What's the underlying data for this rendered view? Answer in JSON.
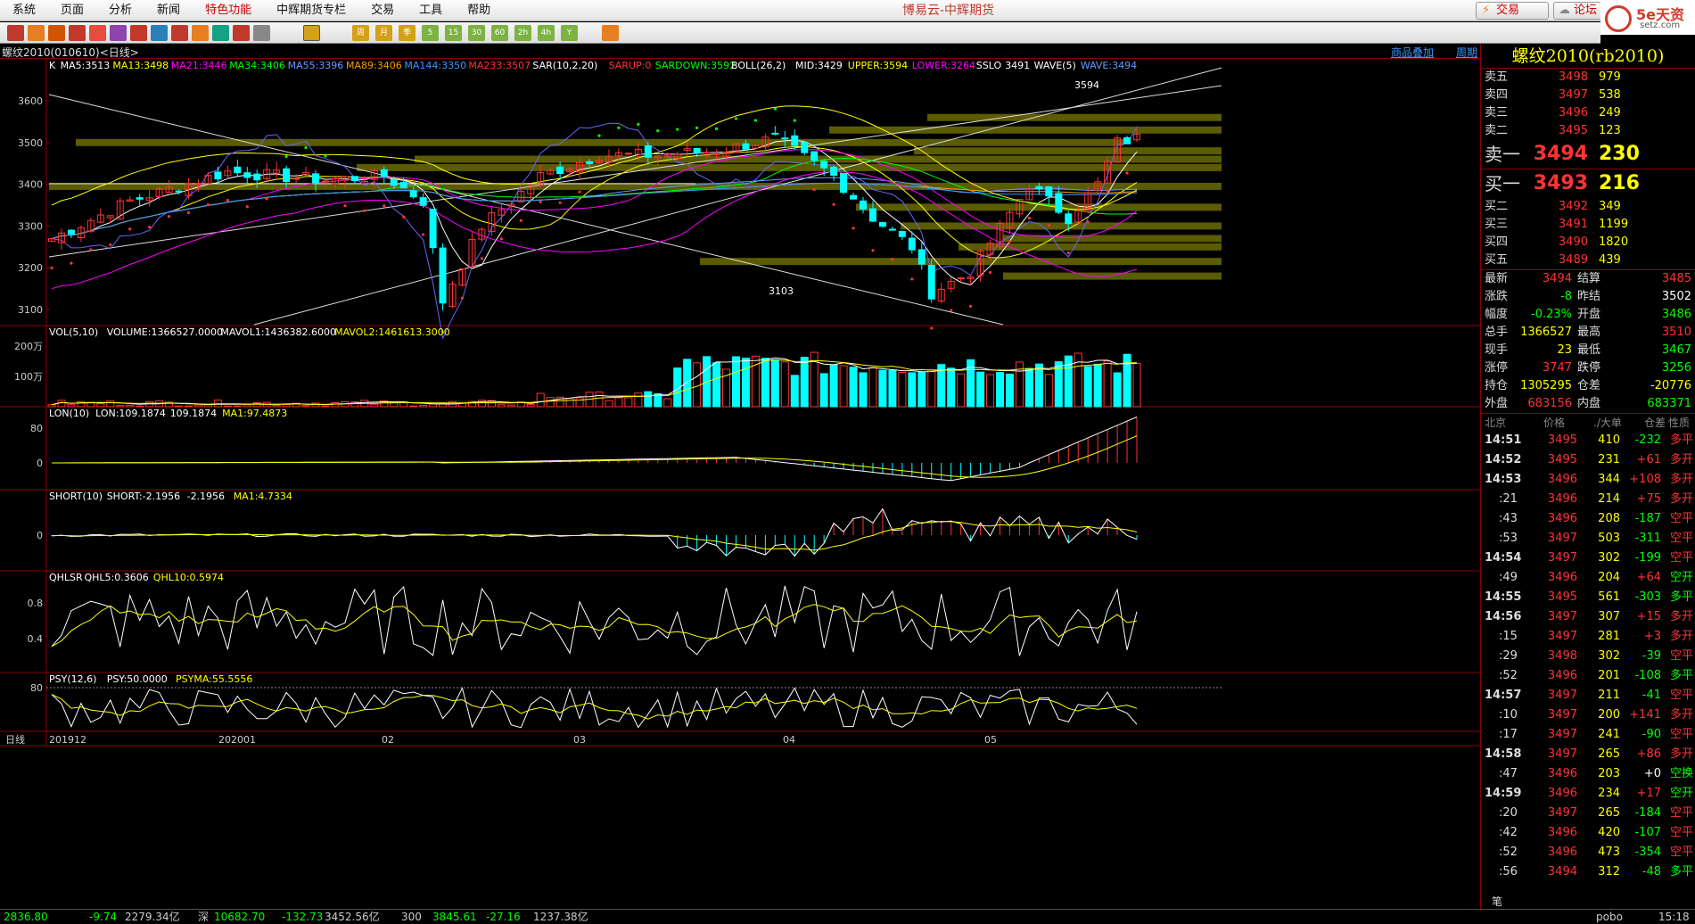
{
  "menu": [
    "系统",
    "页面",
    "分析",
    "新闻",
    "特色功能",
    "中辉期货专栏",
    "交易",
    "工具",
    "帮助"
  ],
  "app_title": "博易云-中辉期货",
  "buttons": {
    "trade": "交易",
    "forum": "论坛"
  },
  "logo": {
    "big": "5e天资",
    "small": "setz.com"
  },
  "toolbar_labels": [
    "周",
    "月",
    "季",
    "5",
    "15",
    "30",
    "60",
    "2h",
    "4h",
    "Y"
  ],
  "chart": {
    "symbol": "螺纹2010(010610)<日线>",
    "links": [
      "商品叠加",
      "周期"
    ],
    "ma_line": [
      {
        "t": "K",
        "c": "#ffffff"
      },
      {
        "t": "MA5:3513",
        "c": "#ffffff"
      },
      {
        "t": "MA13:3498",
        "c": "#ffff00"
      },
      {
        "t": "MA21:3446",
        "c": "#ff00ff"
      },
      {
        "t": "MA34:3406",
        "c": "#00ff00"
      },
      {
        "t": "MA55:3396",
        "c": "#6699ff"
      },
      {
        "t": "MA89:3406",
        "c": "#ff9900"
      },
      {
        "t": "MA144:3350",
        "c": "#3399ff"
      },
      {
        "t": "MA233:3507",
        "c": "#ff3333"
      },
      {
        "t": "SAR(10,2,20)",
        "c": "#ffffff"
      },
      {
        "t": "SARUP:0",
        "c": "#ff3333"
      },
      {
        "t": "SARDOWN:3592",
        "c": "#00ff00"
      },
      {
        "t": "BOLL(26,2)",
        "c": "#ffffff"
      },
      {
        "t": "MID:3429",
        "c": "#ffffff"
      },
      {
        "t": "UPPER:3594",
        "c": "#ffff00"
      },
      {
        "t": "LOWER:3264",
        "c": "#ff00ff"
      },
      {
        "t": "SSLO",
        "c": "#ffffff"
      },
      {
        "t": "3491",
        "c": "#ffffff"
      },
      {
        "t": "WAVE(5)",
        "c": "#ffffff"
      },
      {
        "t": "WAVE:3494",
        "c": "#6699ff"
      }
    ],
    "price_axis": [
      "3600",
      "3500",
      "3400",
      "3300",
      "3200",
      "3100"
    ],
    "high_label": "3594",
    "low_label": "3103",
    "vol_line": [
      {
        "t": "VOL(5,10)",
        "c": "#fff"
      },
      {
        "t": "VOLUME:1366527.0000",
        "c": "#fff"
      },
      {
        "t": "MAVOL1:1436382.6000",
        "c": "#fff"
      },
      {
        "t": "MAVOL2:1461613.3000",
        "c": "#ff0"
      }
    ],
    "vol_axis": [
      "200万",
      "100万"
    ],
    "lon_line": [
      {
        "t": "LON(10)",
        "c": "#fff"
      },
      {
        "t": "LON:109.1874",
        "c": "#fff"
      },
      {
        "t": "109.1874",
        "c": "#fff"
      },
      {
        "t": "MA1:97.4873",
        "c": "#ff0"
      }
    ],
    "lon_axis": [
      "80",
      "0"
    ],
    "short_line": [
      {
        "t": "SHORT(10)",
        "c": "#fff"
      },
      {
        "t": "SHORT:-2.1956",
        "c": "#fff"
      },
      {
        "t": "-2.1956",
        "c": "#fff"
      },
      {
        "t": "MA1:4.7334",
        "c": "#ff0"
      }
    ],
    "short_axis": [
      "0"
    ],
    "qhlsr_line": [
      {
        "t": "QHLSR",
        "c": "#fff"
      },
      {
        "t": "QHL5:0.3606",
        "c": "#fff"
      },
      {
        "t": "QHL10:0.5974",
        "c": "#ff0"
      }
    ],
    "qhlsr_axis": [
      "0.8",
      "0.4"
    ],
    "psy_line": [
      {
        "t": "PSY(12,6)",
        "c": "#fff"
      },
      {
        "t": "PSY:50.0000",
        "c": "#fff"
      },
      {
        "t": "PSYMA:55.5556",
        "c": "#ff0"
      }
    ],
    "psy_axis": [
      "80"
    ],
    "date_axis": [
      "日线",
      "201912",
      "202001",
      "02",
      "03",
      "04",
      "05"
    ]
  },
  "quote": {
    "title": "螺纹2010(rb2010)",
    "asks": [
      {
        "l": "卖五",
        "p": "3498",
        "v": "979"
      },
      {
        "l": "卖四",
        "p": "3497",
        "v": "538"
      },
      {
        "l": "卖三",
        "p": "3496",
        "v": "249"
      },
      {
        "l": "卖二",
        "p": "3495",
        "v": "123"
      },
      {
        "l": "卖一",
        "p": "3494",
        "v": "230"
      }
    ],
    "bids": [
      {
        "l": "买一",
        "p": "3493",
        "v": "216"
      },
      {
        "l": "买二",
        "p": "3492",
        "v": "349"
      },
      {
        "l": "买三",
        "p": "3491",
        "v": "1199"
      },
      {
        "l": "买四",
        "p": "3490",
        "v": "1820"
      },
      {
        "l": "买五",
        "p": "3489",
        "v": "439"
      }
    ],
    "stats": [
      {
        "l1": "最新",
        "v1": "3494",
        "c1": "#f33",
        "l2": "结算",
        "v2": "3485",
        "c2": "#f33"
      },
      {
        "l1": "涨跌",
        "v1": "-8",
        "c1": "#0f0",
        "l2": "昨结",
        "v2": "3502",
        "c2": "#fff"
      },
      {
        "l1": "幅度",
        "v1": "-0.23%",
        "c1": "#0f0",
        "l2": "开盘",
        "v2": "3486",
        "c2": "#0f0"
      },
      {
        "l1": "总手",
        "v1": "1366527",
        "c1": "#ff0",
        "l2": "最高",
        "v2": "3510",
        "c2": "#f33"
      },
      {
        "l1": "现手",
        "v1": "23",
        "c1": "#ff0",
        "l2": "最低",
        "v2": "3467",
        "c2": "#0f0"
      },
      {
        "l1": "涨停",
        "v1": "3747",
        "c1": "#f33",
        "l2": "跌停",
        "v2": "3256",
        "c2": "#0f0"
      },
      {
        "l1": "持仓",
        "v1": "1305295",
        "c1": "#ff0",
        "l2": "仓差",
        "v2": "-20776",
        "c2": "#ff0"
      },
      {
        "l1": "外盘",
        "v1": "683156",
        "c1": "#f33",
        "l2": "内盘",
        "v2": "683371",
        "c2": "#0f0"
      }
    ],
    "tick_header": [
      "北京",
      "价格",
      "./大单",
      "仓差",
      "性质"
    ],
    "ticks": [
      {
        "t": "14:51",
        "p": "3495",
        "v": "410",
        "d": "-232",
        "k": "多平",
        "pc": "#f33",
        "vc": "#ff0",
        "dc": "#0f0",
        "kc": "#f33"
      },
      {
        "t": "14:52",
        "p": "3495",
        "v": "231",
        "d": "+61",
        "k": "多开",
        "pc": "#f33",
        "vc": "#ff0",
        "dc": "#f33",
        "kc": "#f33"
      },
      {
        "t": "14:53",
        "p": "3496",
        "v": "344",
        "d": "+108",
        "k": "多开",
        "pc": "#f33",
        "vc": "#ff0",
        "dc": "#f33",
        "kc": "#f33"
      },
      {
        "t": ":21",
        "p": "3496",
        "v": "214",
        "d": "+75",
        "k": "多开",
        "pc": "#f33",
        "vc": "#ff0",
        "dc": "#f33",
        "kc": "#f33"
      },
      {
        "t": ":43",
        "p": "3496",
        "v": "208",
        "d": "-187",
        "k": "空平",
        "pc": "#f33",
        "vc": "#ff0",
        "dc": "#0f0",
        "kc": "#f33"
      },
      {
        "t": ":53",
        "p": "3497",
        "v": "503",
        "d": "-311",
        "k": "空平",
        "pc": "#f33",
        "vc": "#ff0",
        "dc": "#0f0",
        "kc": "#f33"
      },
      {
        "t": "14:54",
        "p": "3497",
        "v": "302",
        "d": "-199",
        "k": "空平",
        "pc": "#f33",
        "vc": "#ff0",
        "dc": "#0f0",
        "kc": "#f33"
      },
      {
        "t": ":49",
        "p": "3496",
        "v": "204",
        "d": "+64",
        "k": "空开",
        "pc": "#f33",
        "vc": "#ff0",
        "dc": "#f33",
        "kc": "#0f0"
      },
      {
        "t": "14:55",
        "p": "3495",
        "v": "561",
        "d": "-303",
        "k": "多平",
        "pc": "#f33",
        "vc": "#ff0",
        "dc": "#0f0",
        "kc": "#0f0"
      },
      {
        "t": "14:56",
        "p": "3497",
        "v": "307",
        "d": "+15",
        "k": "多开",
        "pc": "#f33",
        "vc": "#ff0",
        "dc": "#f33",
        "kc": "#f33"
      },
      {
        "t": ":15",
        "p": "3497",
        "v": "281",
        "d": "+3",
        "k": "多开",
        "pc": "#f33",
        "vc": "#ff0",
        "dc": "#f33",
        "kc": "#f33"
      },
      {
        "t": ":29",
        "p": "3498",
        "v": "302",
        "d": "-39",
        "k": "空平",
        "pc": "#f33",
        "vc": "#ff0",
        "dc": "#0f0",
        "kc": "#f33"
      },
      {
        "t": ":52",
        "p": "3496",
        "v": "201",
        "d": "-108",
        "k": "多平",
        "pc": "#f33",
        "vc": "#ff0",
        "dc": "#0f0",
        "kc": "#0f0"
      },
      {
        "t": "14:57",
        "p": "3497",
        "v": "211",
        "d": "-41",
        "k": "空平",
        "pc": "#f33",
        "vc": "#ff0",
        "dc": "#0f0",
        "kc": "#f33"
      },
      {
        "t": ":10",
        "p": "3497",
        "v": "200",
        "d": "+141",
        "k": "多开",
        "pc": "#f33",
        "vc": "#ff0",
        "dc": "#f33",
        "kc": "#f33"
      },
      {
        "t": ":17",
        "p": "3497",
        "v": "241",
        "d": "-90",
        "k": "空平",
        "pc": "#f33",
        "vc": "#ff0",
        "dc": "#0f0",
        "kc": "#f33"
      },
      {
        "t": "14:58",
        "p": "3497",
        "v": "265",
        "d": "+86",
        "k": "多开",
        "pc": "#f33",
        "vc": "#ff0",
        "dc": "#f33",
        "kc": "#f33"
      },
      {
        "t": ":47",
        "p": "3496",
        "v": "203",
        "d": "+0",
        "k": "空换",
        "pc": "#f33",
        "vc": "#ff0",
        "dc": "#fff",
        "kc": "#0f0"
      },
      {
        "t": "14:59",
        "p": "3496",
        "v": "234",
        "d": "+17",
        "k": "空开",
        "pc": "#f33",
        "vc": "#ff0",
        "dc": "#f33",
        "kc": "#0f0"
      },
      {
        "t": ":20",
        "p": "3497",
        "v": "265",
        "d": "-184",
        "k": "空平",
        "pc": "#f33",
        "vc": "#ff0",
        "dc": "#0f0",
        "kc": "#f33"
      },
      {
        "t": ":42",
        "p": "3496",
        "v": "420",
        "d": "-107",
        "k": "空平",
        "pc": "#f33",
        "vc": "#ff0",
        "dc": "#0f0",
        "kc": "#f33"
      },
      {
        "t": ":52",
        "p": "3496",
        "v": "473",
        "d": "-354",
        "k": "空平",
        "pc": "#f33",
        "vc": "#ff0",
        "dc": "#0f0",
        "kc": "#f33"
      },
      {
        "t": ":56",
        "p": "3494",
        "v": "312",
        "d": "-48",
        "k": "多平",
        "pc": "#f33",
        "vc": "#ff0",
        "dc": "#0f0",
        "kc": "#0f0"
      }
    ],
    "footer_tab": "笔"
  },
  "status": [
    {
      "t": "2836.80",
      "c": "#0f0"
    },
    {
      "t": "-9.74",
      "c": "#0f0"
    },
    {
      "t": "2279.34亿",
      "c": "#ccc"
    },
    {
      "t": "深",
      "c": "#ccc"
    },
    {
      "t": "10682.70",
      "c": "#0f0"
    },
    {
      "t": "-132.73",
      "c": "#0f0"
    },
    {
      "t": "3452.56亿",
      "c": "#ccc"
    },
    {
      "t": "300",
      "c": "#ccc"
    },
    {
      "t": "3845.61",
      "c": "#0f0"
    },
    {
      "t": "-27.16",
      "c": "#0f0"
    },
    {
      "t": "1237.38亿",
      "c": "#ccc"
    },
    {
      "t": "pobo",
      "c": "#ccc"
    },
    {
      "t": "15:18",
      "c": "#ccc"
    }
  ]
}
